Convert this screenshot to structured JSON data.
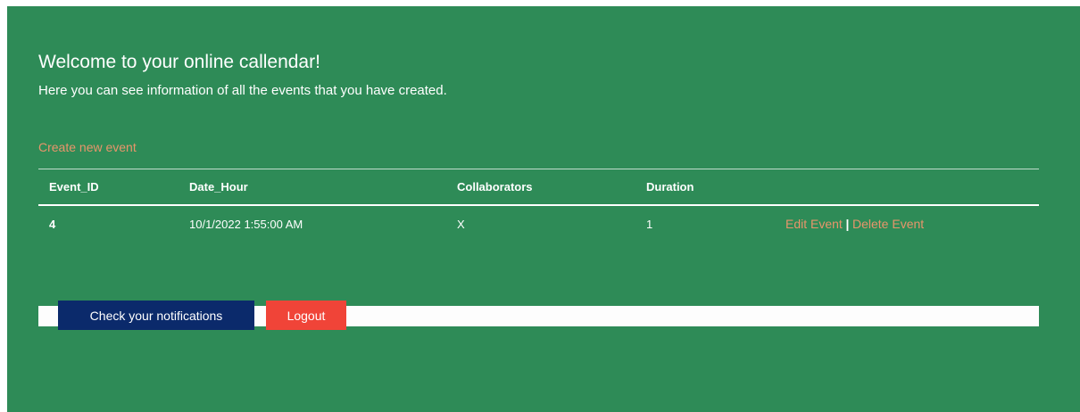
{
  "header": {
    "title": "Welcome to your online callendar!",
    "subtitle": "Here you can see information of all the events that you have created."
  },
  "actions": {
    "create_event": "Create new event",
    "check_notifications": "Check your notifications",
    "logout": "Logout"
  },
  "table": {
    "columns": [
      "Event_ID",
      "Date_Hour",
      "Collaborators",
      "Duration",
      ""
    ],
    "rows": [
      {
        "event_id": "4",
        "date_hour": "10/1/2022 1:55:00 AM",
        "collaborators": "X",
        "duration": "1",
        "edit_label": "Edit Event",
        "separator": "|",
        "delete_label": "Delete Event"
      }
    ]
  },
  "colors": {
    "background": "#2e8b57",
    "link": "#e8956b",
    "notifications_button": "#0b2a6b",
    "logout_button": "#f04438"
  }
}
